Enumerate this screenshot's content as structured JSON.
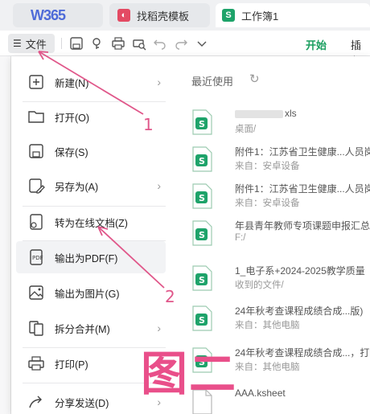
{
  "tabs": {
    "home": "W365",
    "template": "找稻壳模板",
    "sheet": "工作簿1",
    "template_icon": "daoke-icon",
    "sheet_icon": "S"
  },
  "toolbar": {
    "file_label": "文件",
    "start_tab": "开始",
    "insert_tab": "插入",
    "accent": "#1a9e5f"
  },
  "menu": {
    "items": [
      {
        "label": "新建(N)",
        "icon": "new-file-icon",
        "submenu": true
      },
      {
        "label": "打开(O)",
        "icon": "folder-icon",
        "submenu": false
      },
      {
        "label": "保存(S)",
        "icon": "save-icon",
        "submenu": false
      },
      {
        "label": "另存为(A)",
        "icon": "save-as-icon",
        "submenu": true
      },
      {
        "label": "转为在线文档(Z)",
        "icon": "cloud-doc-icon",
        "submenu": false
      },
      {
        "label": "输出为PDF(F)",
        "icon": "pdf-icon",
        "submenu": false
      },
      {
        "label": "输出为图片(G)",
        "icon": "image-icon",
        "submenu": false
      },
      {
        "label": "拆分合并(M)",
        "icon": "split-merge-icon",
        "submenu": true
      },
      {
        "label": "打印(P)",
        "icon": "print-icon",
        "submenu": true
      },
      {
        "label": "分享发送(D)",
        "icon": "share-icon",
        "submenu": true
      }
    ]
  },
  "recent": {
    "title": "最近使用",
    "files": [
      {
        "name": "xls",
        "sub": "桌面/"
      },
      {
        "name": "附件1：江苏省卫生健康...人员岗",
        "sub": "来自：安卓设备"
      },
      {
        "name": "附件1：江苏省卫生健康...人员岗",
        "sub": "来自：安卓设备"
      },
      {
        "name": "年县青年教师专项课题申报汇总",
        "sub": "F:/"
      },
      {
        "name": "1_电子系+2024-2025教学质量",
        "sub": "收到的文件/"
      },
      {
        "name": "24年秋考查课程成绩合成...版)",
        "sub": "来自：其他电脑"
      },
      {
        "name": "24年秋考查课程成绩合成...，打",
        "sub": "来自：其他电脑"
      },
      {
        "name": "AAA.ksheet",
        "sub": ""
      }
    ]
  },
  "annotations": {
    "num1": "1",
    "num2": "2",
    "big": "图二",
    "color": "#e0578a"
  }
}
